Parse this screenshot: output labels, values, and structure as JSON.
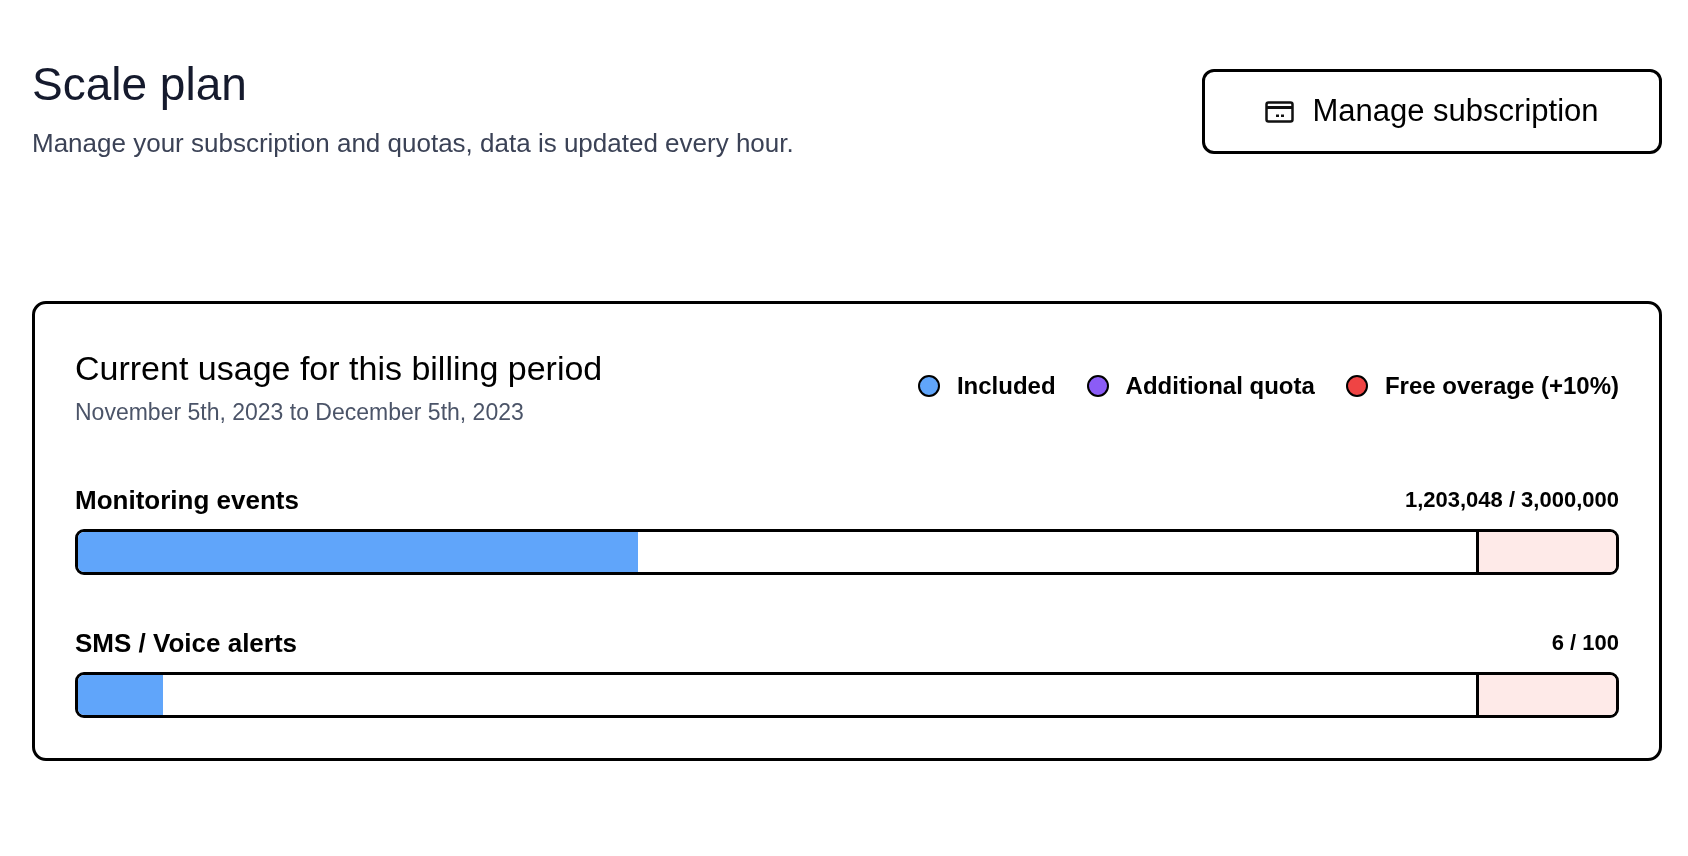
{
  "header": {
    "title": "Scale plan",
    "subtitle": "Manage your subscription and quotas, data is updated every hour.",
    "button": "Manage subscription"
  },
  "usage_card": {
    "title": "Current usage for this billing period",
    "period": "November 5th, 2023 to December 5th, 2023",
    "legend": [
      {
        "label": "Included",
        "color": "#60a5fa"
      },
      {
        "label": "Additional quota",
        "color": "#8b5cf6"
      },
      {
        "label": "Free overage (+10%)",
        "color": "#ef4444"
      }
    ],
    "meters": [
      {
        "name": "Monitoring events",
        "reading": "1,203,048 / 3,000,000",
        "level": 0.364
      },
      {
        "name": "SMS / Voice alerts",
        "reading": "6 / 100",
        "level": 0.055
      }
    ]
  }
}
